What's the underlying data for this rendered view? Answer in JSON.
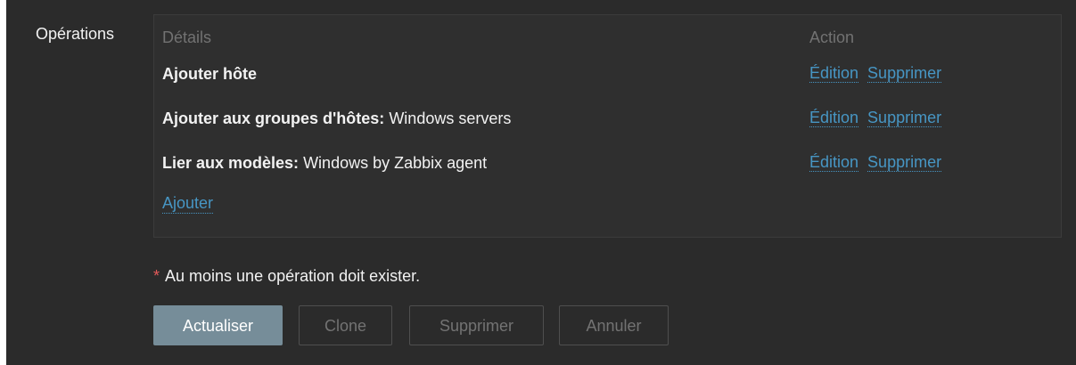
{
  "form": {
    "label": "Opérations",
    "columns": {
      "details": "Détails",
      "action": "Action"
    },
    "operations": [
      {
        "bold": "Ajouter hôte",
        "text": "",
        "edit": "Édition",
        "remove": "Supprimer"
      },
      {
        "bold": "Ajouter aux groupes d'hôtes:",
        "text": " Windows servers",
        "edit": "Édition",
        "remove": "Supprimer"
      },
      {
        "bold": "Lier aux modèles:",
        "text": " Windows by Zabbix agent",
        "edit": "Édition",
        "remove": "Supprimer"
      }
    ],
    "add_link": "Ajouter",
    "required_mark": "*",
    "note": "Au moins une opération doit exister."
  },
  "buttons": {
    "update": "Actualiser",
    "clone": "Clone",
    "delete": "Supprimer",
    "cancel": "Annuler"
  },
  "colors": {
    "background": "#2b2b2b",
    "link": "#4796c4",
    "primary_button": "#768d99",
    "required": "#e45959"
  }
}
